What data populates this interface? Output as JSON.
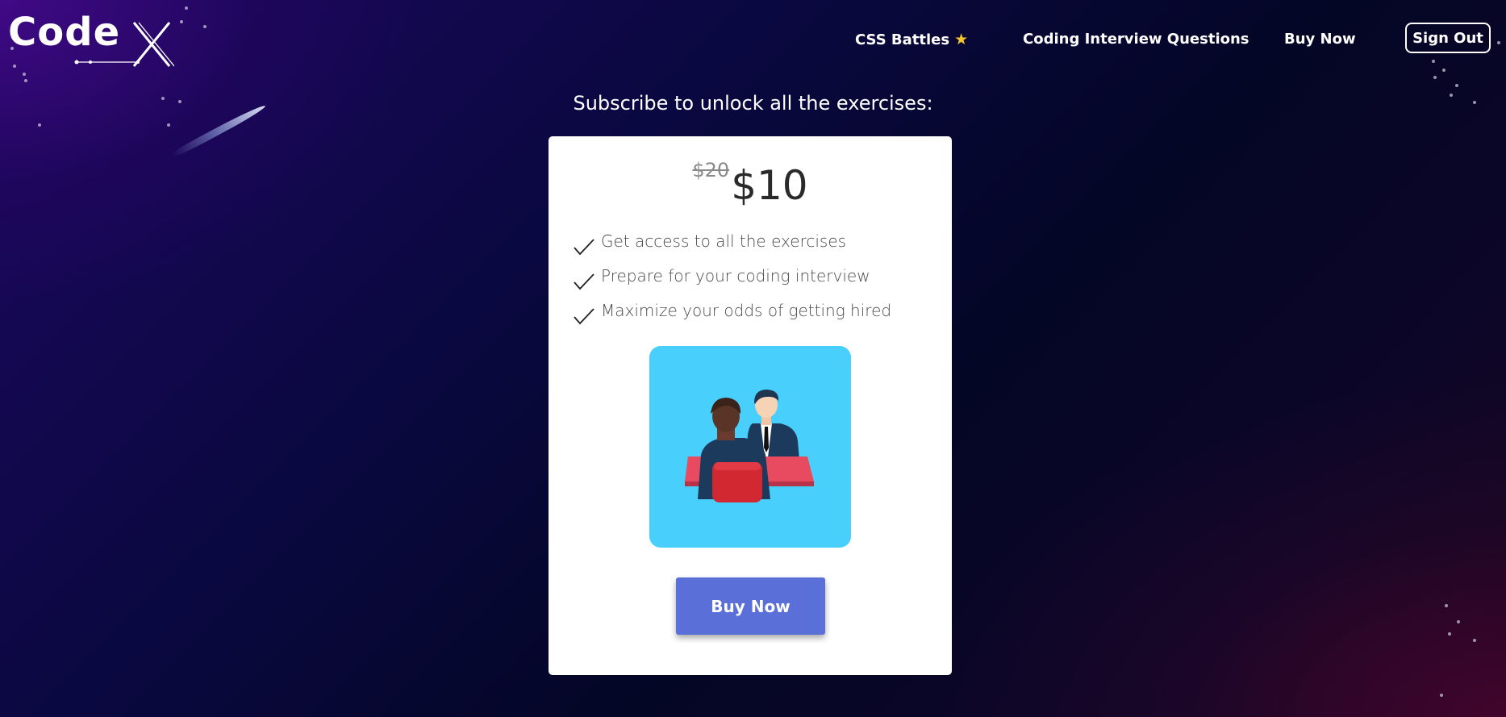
{
  "header": {
    "logo_text": "Code",
    "logo_accent": "X",
    "nav": {
      "css_battles": "CSS Battles",
      "coding_interview": "Coding Interview Questions",
      "buy_now": "Buy Now",
      "sign_out": "Sign Out"
    }
  },
  "main": {
    "subtitle": "Subscribe to unlock all the exercises:"
  },
  "card": {
    "old_price": "$20",
    "new_price": "$10",
    "features": [
      "Get access to all the exercises",
      "Prepare for your coding interview",
      "Maximize your odds of getting hired"
    ],
    "illustration": "interview-illustration",
    "buy_button": "Buy Now"
  },
  "icons": {
    "nav_star": "star-icon",
    "feature_check": "check-icon"
  },
  "colors": {
    "accent_button": "#5b6fd8",
    "illustration_bg": "#48cffb",
    "star": "#f7c52b"
  }
}
